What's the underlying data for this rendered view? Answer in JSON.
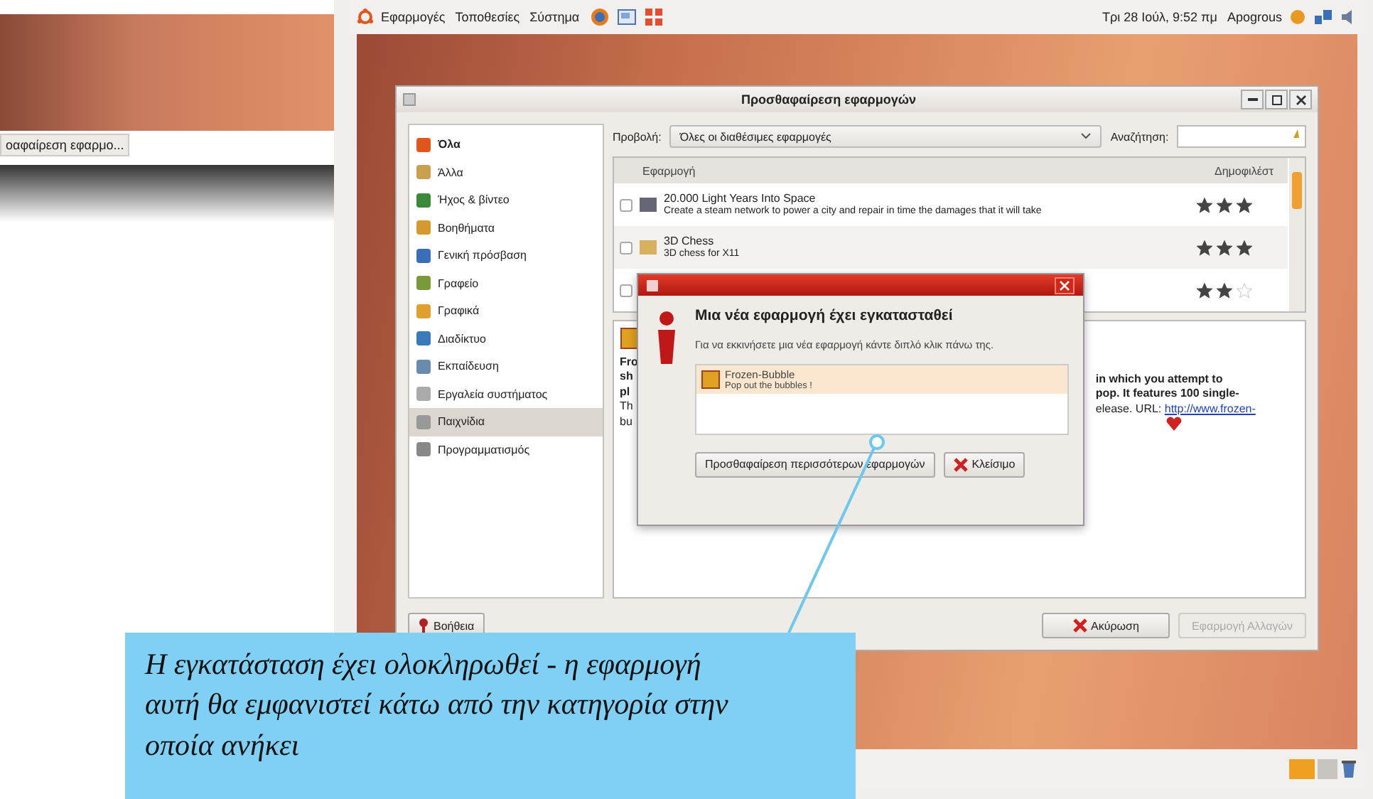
{
  "side_screenshot": {
    "button": "οαφαίρεση εφαρμο..."
  },
  "top_panel": {
    "menus": [
      "Εφαρμογές",
      "Τοποθεσίες",
      "Σύστημα"
    ],
    "clock": "Τρι 28 Ιούλ, 9:52 πμ",
    "user": "Apogrous"
  },
  "window": {
    "title": "Προσθαφαίρεση εφαρμογών",
    "categories": [
      {
        "label": "Όλα",
        "selected": false
      },
      {
        "label": "Άλλα",
        "selected": false
      },
      {
        "label": "Ήχος & βίντεο",
        "selected": false
      },
      {
        "label": "Βοηθήματα",
        "selected": false
      },
      {
        "label": "Γενική πρόσβαση",
        "selected": false
      },
      {
        "label": "Γραφείο",
        "selected": false
      },
      {
        "label": "Γραφικά",
        "selected": false
      },
      {
        "label": "Διαδίκτυο",
        "selected": false
      },
      {
        "label": "Εκπαίδευση",
        "selected": false
      },
      {
        "label": "Εργαλεία συστήματος",
        "selected": false
      },
      {
        "label": "Παιχνίδια",
        "selected": true
      },
      {
        "label": "Προγραμματισμός",
        "selected": false
      }
    ],
    "view_label": "Προβολή:",
    "view_value": "Όλες οι διαθέσιμες εφαρμογές",
    "search_label": "Αναζήτηση:",
    "table": {
      "columns": [
        "Εφαρμογή",
        "Δημοφιλέστ"
      ],
      "rows": [
        {
          "checked": false,
          "name": "20.000 Light Years Into Space",
          "description": "Create a steam network to power a city and repair in time the damages that it will take",
          "stars": 3
        },
        {
          "checked": false,
          "name": "3D Chess",
          "description": "3D chess for X11",
          "stars": 3
        },
        {
          "checked": false,
          "stars": 2
        }
      ]
    },
    "description": {
      "left": [
        "Fro",
        "sh",
        "pl",
        "Th",
        "bu"
      ],
      "right": [
        "in which you attempt to",
        "pop. It features 100 single-",
        "elease. URL:"
      ],
      "link": "http://www.frozen-"
    },
    "help_button": "Βοήθεια",
    "cancel_button": "Ακύρωση",
    "apply_button": {
      "label": "Εφαρμογή Αλλαγών",
      "disabled": true
    }
  },
  "dialog": {
    "title": "Μια νέα εφαρμογή έχει εγκατασταθεί",
    "message": "Για να εκκινήσετε μια νέα εφαρμογή κάντε διπλό κλικ πάνω της.",
    "apps": [
      {
        "name": "Frozen-Bubble",
        "description": "Pop out the bubbles !"
      }
    ],
    "more_button": "Προσθαφαίρεση περισσότερων εφαρμογών",
    "close_button": "Κλείσιμο"
  },
  "callout": {
    "text": "Η εγκατάσταση έχει ολοκληρωθεί - η εφαρμογή αυτή θα εμφανιστεί κάτω από την κατηγορία στην οποία ανήκει"
  }
}
